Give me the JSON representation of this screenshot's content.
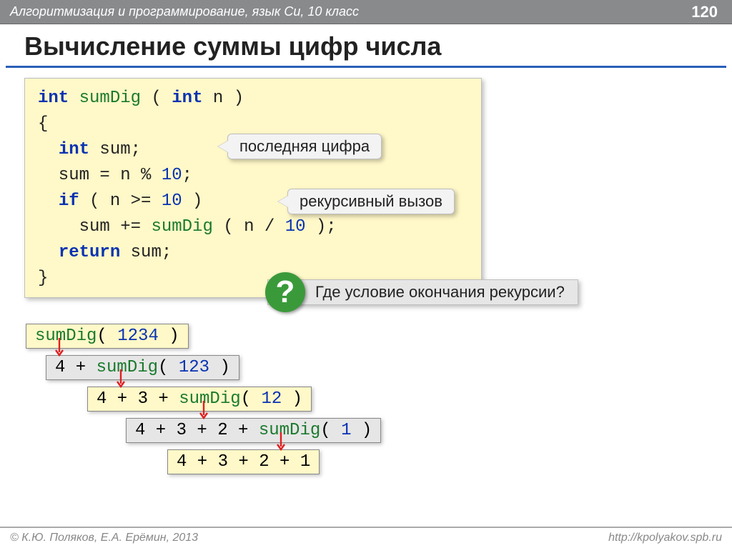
{
  "header": {
    "course": "Алгоритмизация и программирование, язык Си, 10 класс",
    "page": "120"
  },
  "title": "Вычисление суммы цифр числа",
  "code": {
    "l1_int": "int",
    "l1_fn": "sumDig",
    "l1_p1": " ( ",
    "l1_int2": "int",
    "l1_p2": " n )",
    "l2": "{",
    "l3_int": "int",
    "l3_r": " sum;",
    "l4_a": "  sum = n % ",
    "l4_n": "10",
    "l4_b": ";",
    "l5_if": "if",
    "l5_a": " ( n >= ",
    "l5_n": "10",
    "l5_b": " )",
    "l6_a": "    sum += ",
    "l6_fn": "sumDig",
    "l6_b": " ( n / ",
    "l6_n": "10",
    "l6_c": " );",
    "l7_ret": "return",
    "l7_r": " sum;",
    "l8": "}"
  },
  "callouts": {
    "lastDigit": "последняя цифра",
    "recCall": "рекурсивный вызов"
  },
  "question": "Где условие окончания рекурсии?",
  "questionMark": "?",
  "trace": {
    "s1_fn": "sumDig",
    "s1_a": "( ",
    "s1_n": "1234",
    "s1_b": " )",
    "s2_a": "4 + ",
    "s2_fn": "sumDig",
    "s2_p1": "( ",
    "s2_n": "123",
    "s2_p2": " )",
    "s3_a": "4 + 3 + ",
    "s3_fn": "sumDig",
    "s3_p1": "( ",
    "s3_n": "12",
    "s3_p2": " )",
    "s4_a": "4 + 3 + 2 + ",
    "s4_fn": "sumDig",
    "s4_p1": "( ",
    "s4_n": "1",
    "s4_p2": " )",
    "s5": "4 + 3 + 2 + 1"
  },
  "footer": {
    "left": "© К.Ю. Поляков, Е.А. Ерёмин, 2013",
    "right": "http://kpolyakov.spb.ru"
  }
}
